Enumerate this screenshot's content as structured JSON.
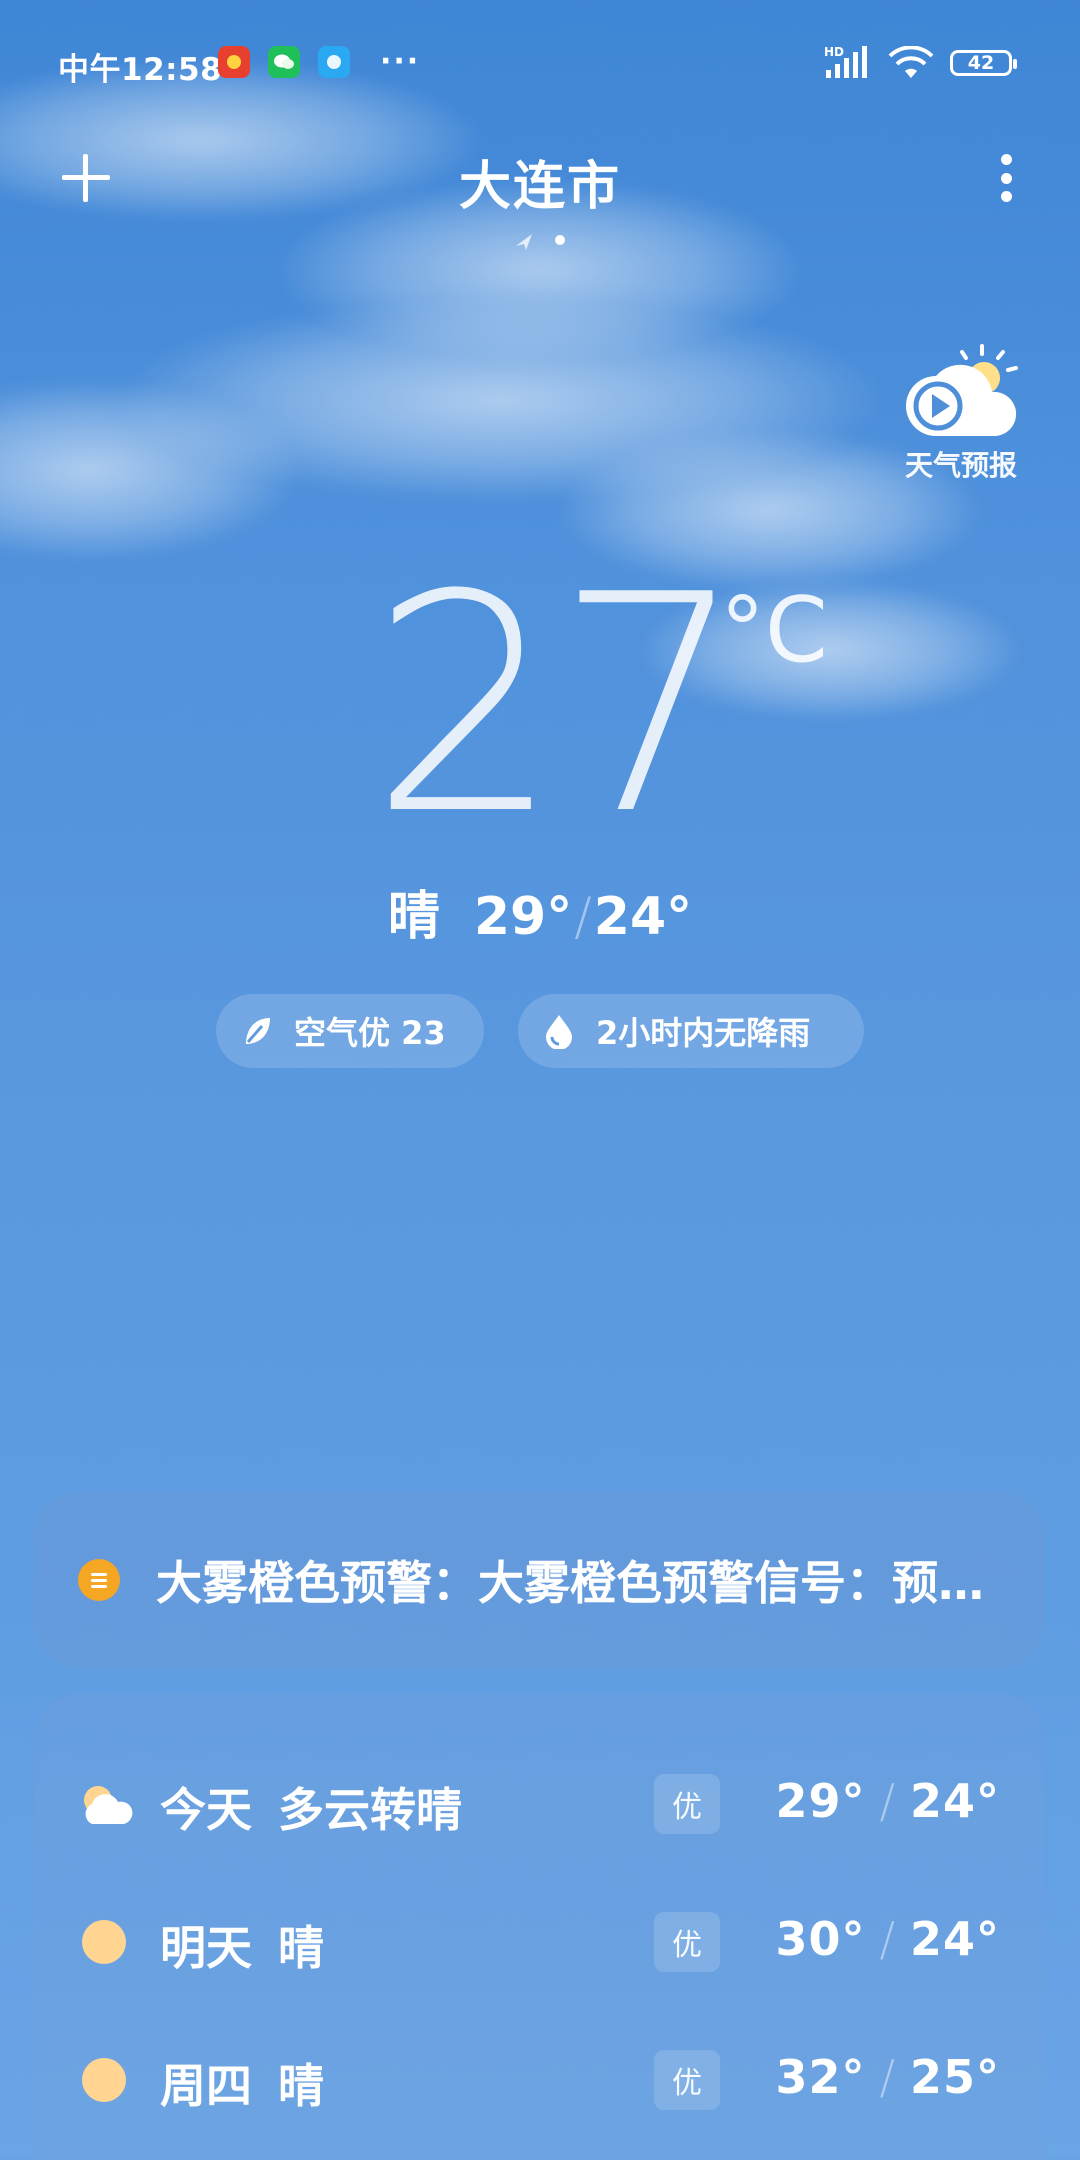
{
  "status_bar": {
    "time": "中午12:58",
    "dots": "···",
    "network": "HD",
    "battery": "42"
  },
  "header": {
    "city": "大连市",
    "add_icon": "plus-icon",
    "more_icon": "more-vertical-icon"
  },
  "forecast_video": {
    "label": "天气预报",
    "icon": "play-cloud-sun-icon"
  },
  "current": {
    "temperature": "27",
    "unit": "°C",
    "condition": "晴",
    "high": "29°",
    "low": "24°"
  },
  "pills": {
    "air_quality": "空气优 23",
    "rain": "2小时内无降雨"
  },
  "warning": {
    "text": "大雾橙色预警：大雾橙色预警信号：预…",
    "color": "#f5a623"
  },
  "daily": [
    {
      "day": "今天",
      "condition": "多云转晴",
      "aqi": "优",
      "high": "29°",
      "low": "24°",
      "icon": "partly-cloudy-icon"
    },
    {
      "day": "明天",
      "condition": "晴",
      "aqi": "优",
      "high": "30°",
      "low": "24°",
      "icon": "sun-icon"
    },
    {
      "day": "周四",
      "condition": "晴",
      "aqi": "优",
      "high": "32°",
      "low": "25°",
      "icon": "sun-icon"
    }
  ],
  "colors": {
    "sky_top": "#3f86d6",
    "sky_bottom": "#6aa5e6",
    "sun": "#ffd591"
  }
}
